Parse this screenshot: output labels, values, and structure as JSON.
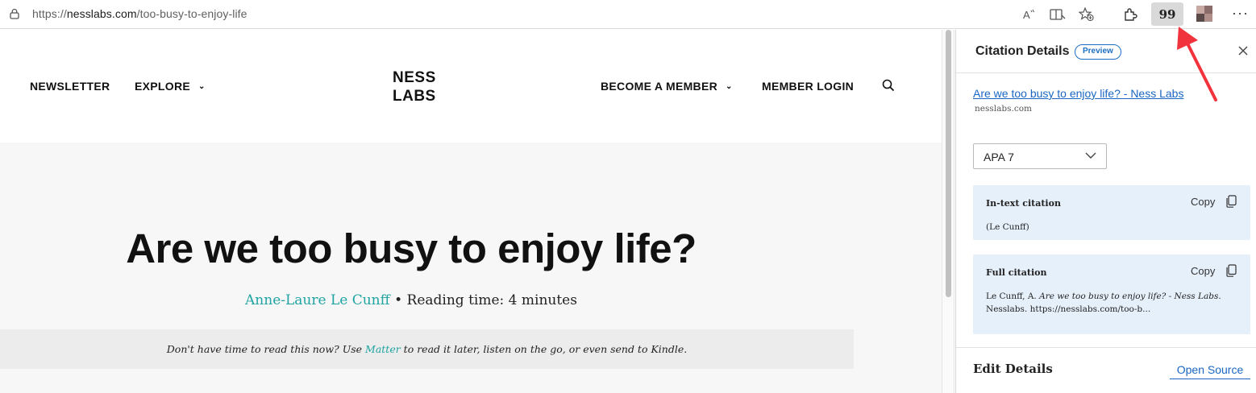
{
  "browser": {
    "url_prefix": "https://",
    "url_host": "nesslabs.com",
    "url_path": "/too-busy-to-enjoy-life",
    "citation_button_glyph": "99",
    "more_glyph": "···"
  },
  "site": {
    "nav_left": [
      "NEWSLETTER",
      "EXPLORE"
    ],
    "logo_line1": "NESS",
    "logo_line2": "LABS",
    "nav_right": [
      "BECOME A MEMBER",
      "MEMBER LOGIN"
    ],
    "chevron": "⌄"
  },
  "article": {
    "title": "Are we too busy to enjoy life?",
    "author": "Anne-Laure Le Cunff",
    "reading_time": "• Reading time: 4 minutes",
    "notice_before": "Don't have time to read this now? Use ",
    "notice_link": "Matter",
    "notice_after": " to read it later, listen on the go, or even send to Kindle."
  },
  "panel": {
    "title": "Citation Details",
    "badge": "Preview",
    "source_title": "Are we too busy to enjoy life? - Ness Labs",
    "source_domain": "nesslabs.com",
    "style_selected": "APA 7",
    "intext_label": "In-text citation",
    "intext_text": "(Le Cunff)",
    "full_label": "Full citation",
    "full_author": "Le Cunff, A. ",
    "full_title": "Are we too busy to enjoy life? - Ness Labs",
    "full_rest": ". Nesslabs. https://nesslabs.com/too-b...",
    "copy_label": "Copy",
    "edit_details": "Edit Details",
    "open_source": "Open Source"
  },
  "colors": {
    "accent_teal": "#1fa3a3",
    "link_blue": "#1a66c2",
    "citation_bg": "#e6f0fb",
    "arrow_red": "#f0333c"
  }
}
